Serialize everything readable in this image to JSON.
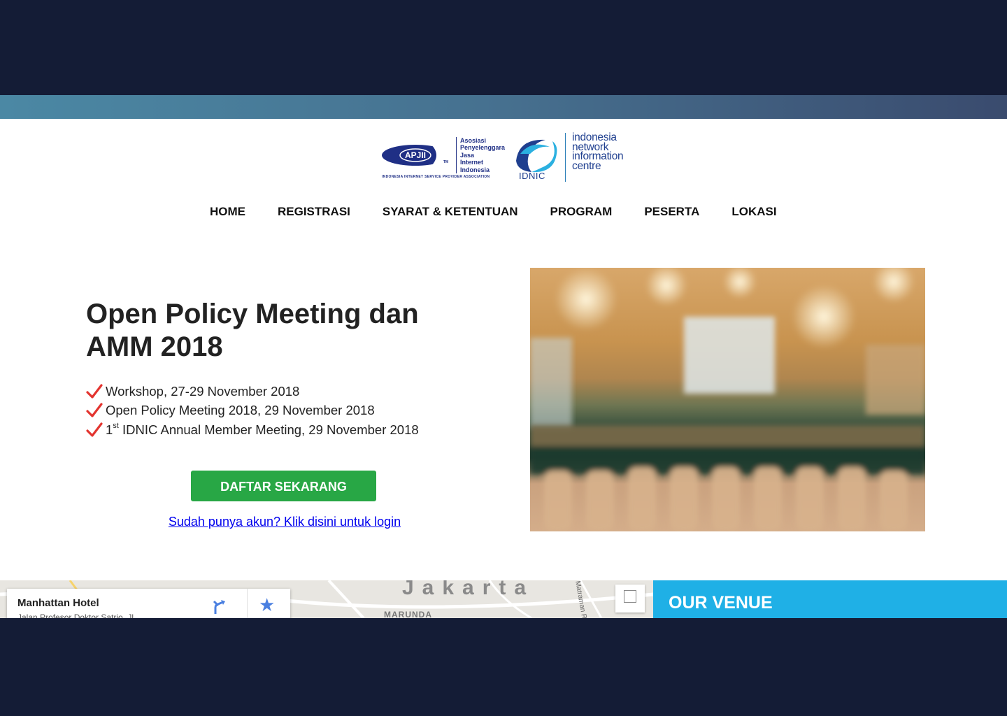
{
  "logos": {
    "apjii": {
      "mark": "APJII",
      "tm": "TM",
      "lines": [
        "Asosiasi",
        "Penyelenggara",
        "Jasa",
        "Internet",
        "Indonesia"
      ],
      "subtitle": "INDONESIA INTERNET SERVICE PROVIDER ASSOCIATION"
    },
    "idnic": {
      "label": "IDNIC",
      "lines": [
        "indonesia",
        "network",
        "information",
        "centre"
      ]
    }
  },
  "nav": [
    {
      "label": "HOME"
    },
    {
      "label": "REGISTRASI"
    },
    {
      "label": "SYARAT & KETENTUAN"
    },
    {
      "label": "PROGRAM"
    },
    {
      "label": "PESERTA"
    },
    {
      "label": "LOKASI"
    }
  ],
  "hero": {
    "title": "Open Policy Meeting dan AMM 2018",
    "features": [
      {
        "text": "Workshop, 27-29 November 2018"
      },
      {
        "text": "Open Policy Meeting 2018, 29 November 2018"
      },
      {
        "prefix": "1",
        "sup": "st",
        "text": " IDNIC Annual Member Meeting, 29 November 2018"
      }
    ],
    "cta_label": "DAFTAR SEKARANG",
    "login_link": "Sudah punya akun? Klik disini untuk login"
  },
  "map": {
    "place_name": "Manhattan Hotel",
    "place_address": "Jalan Profesor Doktor Satrio, Jl...",
    "city_label": "Jakarta",
    "area_label": "MARUNDA",
    "road_label": "Matraman R"
  },
  "venue": {
    "title": "OUR VENUE"
  },
  "colors": {
    "background": "#141c36",
    "cta": "#28a745",
    "venue": "#1fb0e6",
    "check": "#e3342f",
    "brand": "#1f2f85"
  }
}
